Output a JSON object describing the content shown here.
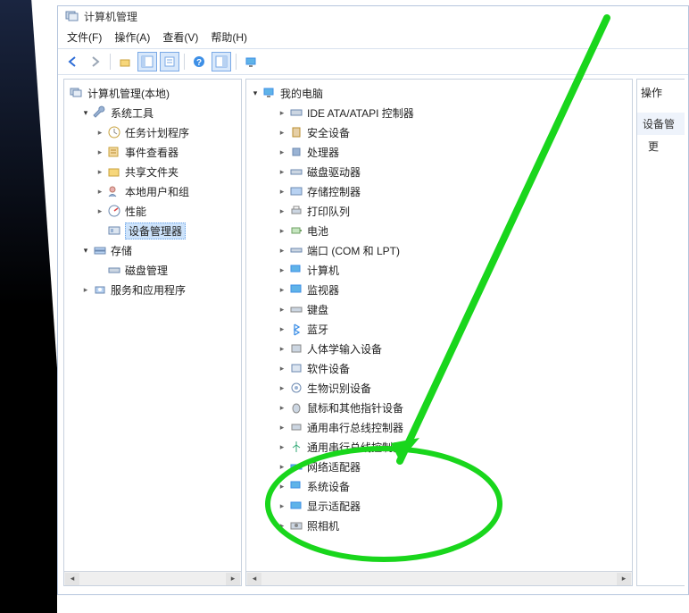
{
  "window": {
    "title": "计算机管理"
  },
  "menu": {
    "file": "文件(F)",
    "action": "操作(A)",
    "view": "查看(V)",
    "help": "帮助(H)"
  },
  "toolbar": {
    "back": "back-icon",
    "forward": "forward-icon",
    "up": "up-icon",
    "show_hide": "show-hide-icon",
    "prop": "properties-icon",
    "help": "help-icon",
    "refresh": "refresh-icon",
    "find": "find-icon",
    "monitor": "monitor-icon"
  },
  "left_tree": {
    "root": "计算机管理(本地)",
    "system_tools": "系统工具",
    "task_scheduler": "任务计划程序",
    "event_viewer": "事件查看器",
    "shared_folders": "共享文件夹",
    "local_users": "本地用户和组",
    "performance": "性能",
    "device_manager": "设备管理器",
    "storage": "存储",
    "disk_mgmt": "磁盘管理",
    "services": "服务和应用程序"
  },
  "center_tree": {
    "root": "我的电脑",
    "ide": "IDE ATA/ATAPI 控制器",
    "security": "安全设备",
    "processor": "处理器",
    "disk_drive": "磁盘驱动器",
    "storage_ctrl": "存储控制器",
    "print_queue": "打印队列",
    "battery": "电池",
    "ports": "端口 (COM 和 LPT)",
    "computer": "计算机",
    "monitor": "监视器",
    "keyboard": "键盘",
    "bluetooth": "蓝牙",
    "hid": "人体学输入设备",
    "software": "软件设备",
    "biometric": "生物识别设备",
    "mouse": "鼠标和其他指针设备",
    "usb_hub": "通用串行总线控制器",
    "usb2": "通用串行总线控制器",
    "network": "网络适配器",
    "system_dev": "系统设备",
    "display": "显示适配器",
    "camera": "照相机"
  },
  "right_panel": {
    "header": "操作",
    "group": "设备管",
    "more": "更"
  },
  "annotation": {
    "target": "network-adapter"
  }
}
